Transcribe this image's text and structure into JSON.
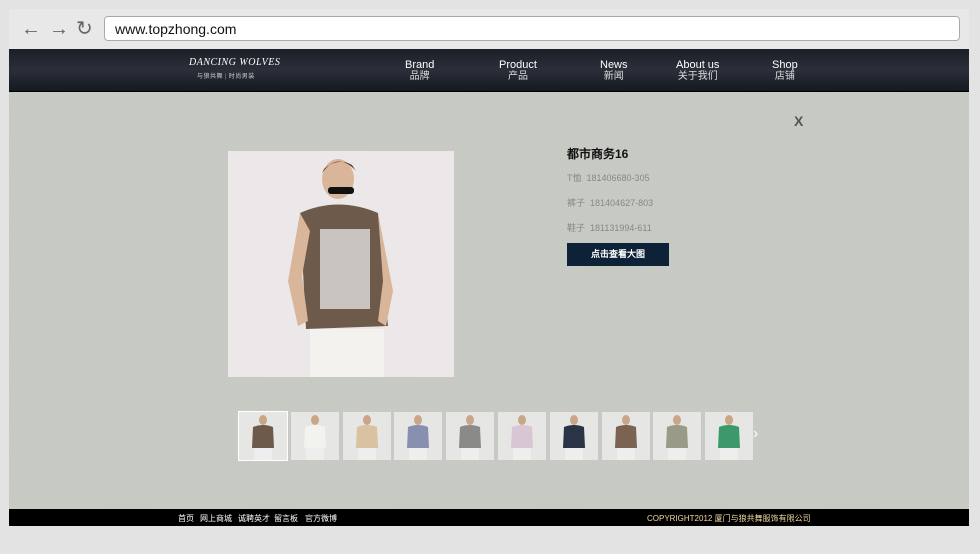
{
  "browser": {
    "url": "www.topzhong.com",
    "back_icon": "arrow-left",
    "forward_icon": "arrow-right",
    "reload_icon": "reload"
  },
  "header": {
    "logo_text": "DANCING WOLVES",
    "logo_sub": "与狼共舞 | 时尚男装",
    "menu": [
      {
        "en": "Brand",
        "zh": "品牌"
      },
      {
        "en": "Product",
        "zh": "产品"
      },
      {
        "en": "News",
        "zh": "新闻"
      },
      {
        "en": "About us",
        "zh": "关于我们"
      },
      {
        "en": "Shop",
        "zh": "店铺"
      }
    ]
  },
  "product": {
    "close_label": "X",
    "title": "都市商务16",
    "items": [
      {
        "label": "T恤",
        "code": "181406680-305"
      },
      {
        "label": "裤子",
        "code": "181404627-803"
      },
      {
        "label": "鞋子",
        "code": "181131994-611"
      }
    ],
    "view_large_label": "点击查看大图",
    "shirt_colors": [
      "#6d5a4b",
      "#f2f2ee",
      "#d8c2a0",
      "#8890b0",
      "#8a8a88",
      "#d8c6d4",
      "#2b3346",
      "#7a6350",
      "#9a9a88",
      "#3c9a6a"
    ],
    "next_icon": "chevron-right"
  },
  "footer": {
    "links": [
      "首页",
      "网上商城",
      "诚聘英才",
      "留言板",
      "官方微博"
    ],
    "copyright": "COPYRIGHT2012 厦门与狼共舞服饰有限公司"
  }
}
